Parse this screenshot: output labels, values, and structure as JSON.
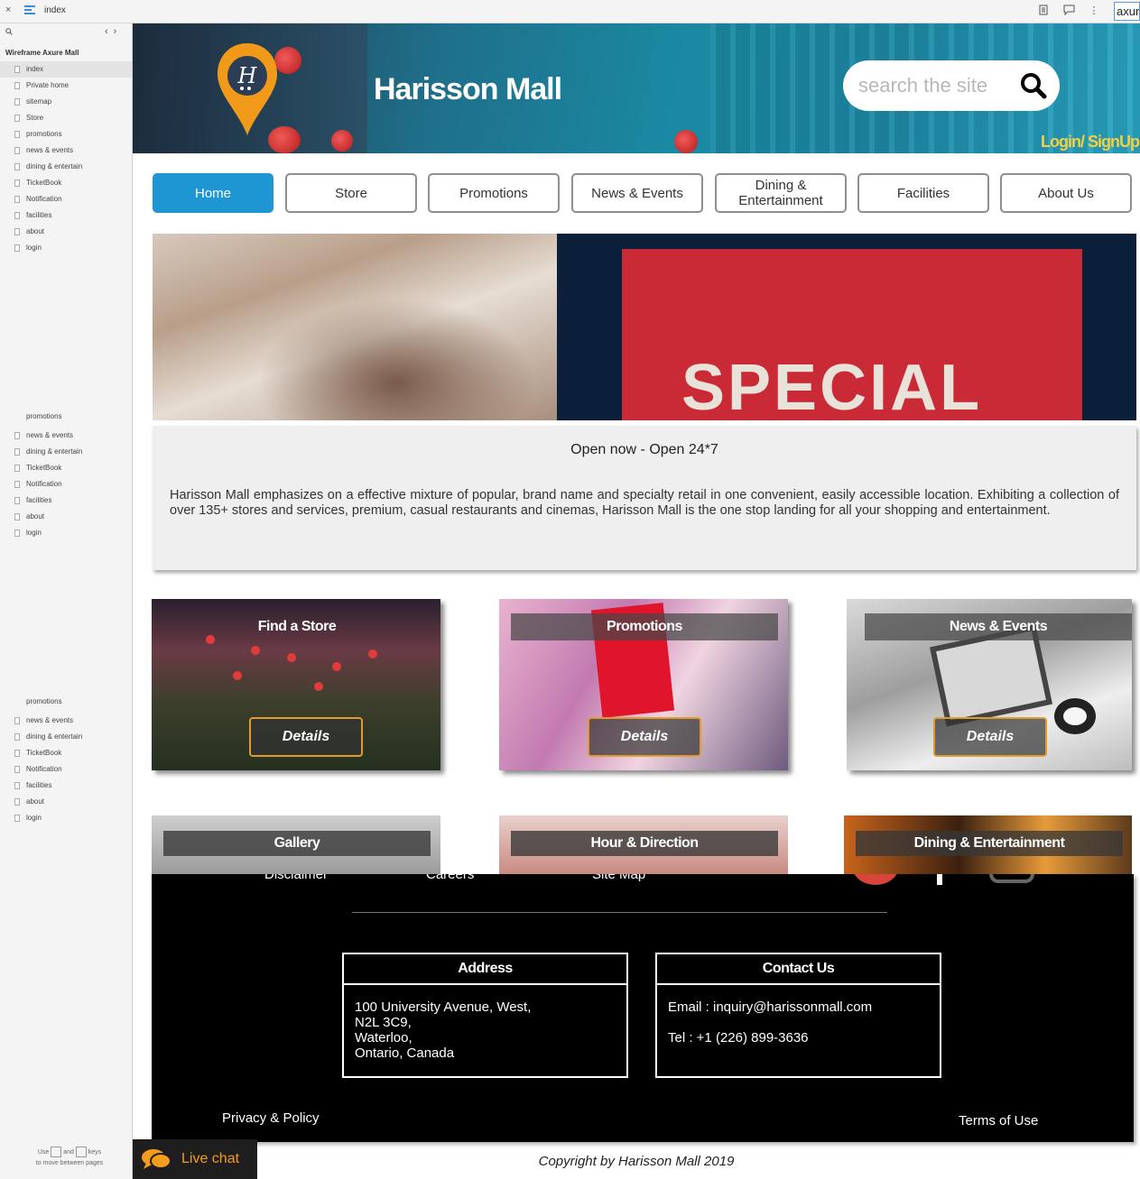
{
  "toolbar": {
    "close_label": "×",
    "page_name": "index",
    "url_fragment": "axur"
  },
  "sidebar": {
    "project": "Wireframe Axure Mall",
    "items": [
      {
        "label": "index"
      },
      {
        "label": "Private home"
      },
      {
        "label": "sitemap"
      },
      {
        "label": "Store"
      },
      {
        "label": "promotions"
      },
      {
        "label": "news & events"
      },
      {
        "label": "dining & entertain"
      },
      {
        "label": "TicketBook"
      },
      {
        "label": "Notification"
      },
      {
        "label": "facilities"
      },
      {
        "label": "about"
      },
      {
        "label": "login"
      }
    ],
    "repeat_items": [
      {
        "label": "promotions"
      },
      {
        "label": "news & events"
      },
      {
        "label": "dining & entertain"
      },
      {
        "label": "TicketBook"
      },
      {
        "label": "Notification"
      },
      {
        "label": "facilities"
      },
      {
        "label": "about"
      },
      {
        "label": "login"
      }
    ],
    "hint_use": "Use",
    "hint_and": "and",
    "hint_keys": "keys",
    "hint_move": "to move between pages"
  },
  "live_chat": {
    "label": "Live chat"
  },
  "header": {
    "title": "Harisson Mall",
    "search_placeholder": "search the site",
    "login_link": "Login/ SignUp"
  },
  "nav": {
    "items": [
      {
        "label": "Home"
      },
      {
        "label": "Store"
      },
      {
        "label": "Promotions"
      },
      {
        "label": "News & Events"
      },
      {
        "label": "Dining & Entertainment"
      },
      {
        "label": "Facilities"
      },
      {
        "label": "About Us"
      }
    ]
  },
  "hero": {
    "banner_text": "SPECIAL"
  },
  "info": {
    "open_status": "Open now - Open 24*7",
    "description": "Harisson Mall emphasizes on a effective mixture of popular, brand name and specialty retail in one convenient, easily accessible location. Exhibiting a collection of over 135+ stores and services, premium, casual restaurants and cinemas, Harisson Mall is the one stop landing for all your shopping and entertainment."
  },
  "cards": [
    {
      "title": "Find a Store",
      "button": "Details"
    },
    {
      "title": "Promotions",
      "button": "Details"
    },
    {
      "title": "News & Events",
      "button": "Details"
    },
    {
      "title": "Gallery"
    },
    {
      "title": "Hour & Direction"
    },
    {
      "title": "Dining & Entertainment"
    }
  ],
  "footer": {
    "links_top": [
      "Disclaimer",
      "Careers",
      "Site Map"
    ],
    "address": {
      "heading": "Address",
      "lines": [
        "100 University Avenue, West,",
        "N2L 3C9,",
        "Waterloo,",
        "Ontario, Canada"
      ]
    },
    "contact": {
      "heading": "Contact Us",
      "email": "Email : inquiry@harissonmall.com",
      "tel": "Tel : +1 (226) 899-3636"
    },
    "privacy": "Privacy & Policy",
    "terms": "Terms of Use",
    "copyright": "Copyright by Harisson Mall  2019"
  },
  "colors": {
    "accent": "#1e96d4",
    "login_link": "#f5cf3f",
    "live_chat": "#f39c1e",
    "details_border": "#e39a2c"
  }
}
